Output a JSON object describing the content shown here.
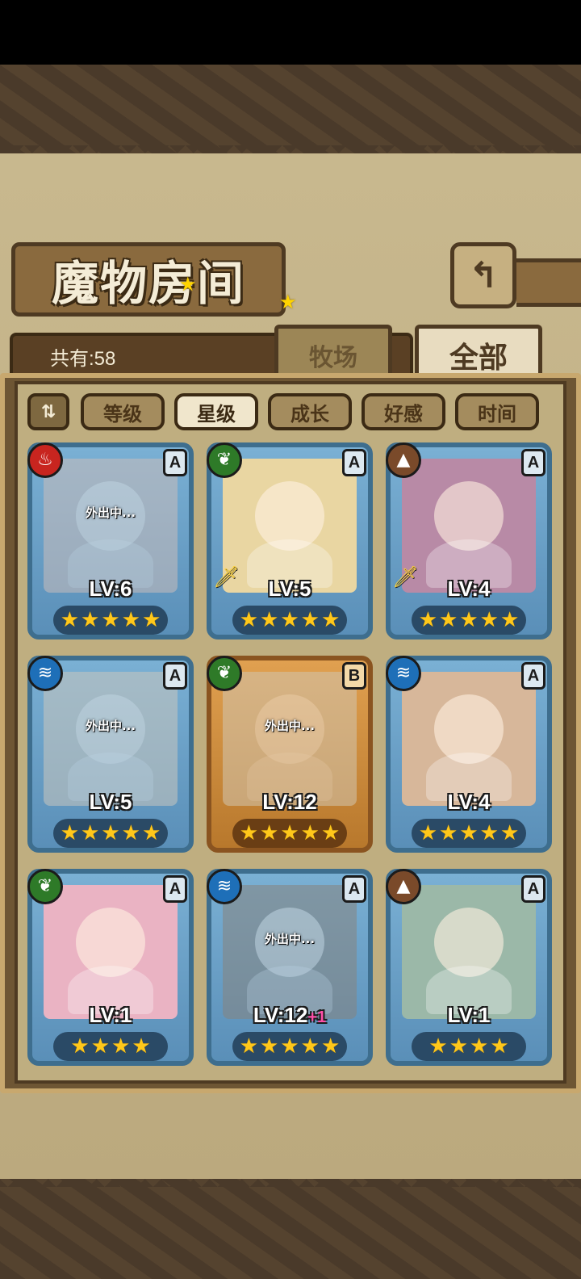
{
  "header": {
    "title": "魔物房间",
    "back_icon": "return-arrow-icon"
  },
  "collection": {
    "count_label": "共有:58"
  },
  "tabs": [
    {
      "label": "牧场",
      "active": false
    },
    {
      "label": "全部",
      "active": true
    }
  ],
  "sort": {
    "toggle_icon": "sort-order-icon",
    "options": [
      {
        "label": "等级",
        "active": false
      },
      {
        "label": "星级",
        "active": true
      },
      {
        "label": "成长",
        "active": false
      },
      {
        "label": "好感",
        "active": false
      },
      {
        "label": "时间",
        "active": false
      }
    ]
  },
  "monsters": [
    {
      "element": "fire",
      "rank": "A",
      "level": "LV:6",
      "stars": 5,
      "away": "外出中...",
      "equip": false
    },
    {
      "element": "wind",
      "rank": "A",
      "level": "LV:5",
      "stars": 5,
      "away": "",
      "equip": true
    },
    {
      "element": "earth",
      "rank": "A",
      "level": "LV:4",
      "stars": 5,
      "away": "",
      "equip": true
    },
    {
      "element": "water",
      "rank": "A",
      "level": "LV:5",
      "stars": 5,
      "away": "外出中...",
      "equip": false
    },
    {
      "element": "wind",
      "rank": "B",
      "level": "LV:12",
      "stars": 5,
      "away": "外出中...",
      "equip": false
    },
    {
      "element": "water",
      "rank": "A",
      "level": "LV:4",
      "stars": 5,
      "away": "",
      "equip": false
    },
    {
      "element": "wind",
      "rank": "A",
      "level": "LV:1",
      "stars": 4,
      "away": "",
      "equip": false
    },
    {
      "element": "water",
      "rank": "A",
      "level": "LV:12",
      "level_bonus": "+1",
      "stars": 5,
      "away": "外出中...",
      "equip": false
    },
    {
      "element": "earth",
      "rank": "A",
      "level": "LV:1",
      "stars": 4,
      "away": "",
      "equip": false
    }
  ]
}
